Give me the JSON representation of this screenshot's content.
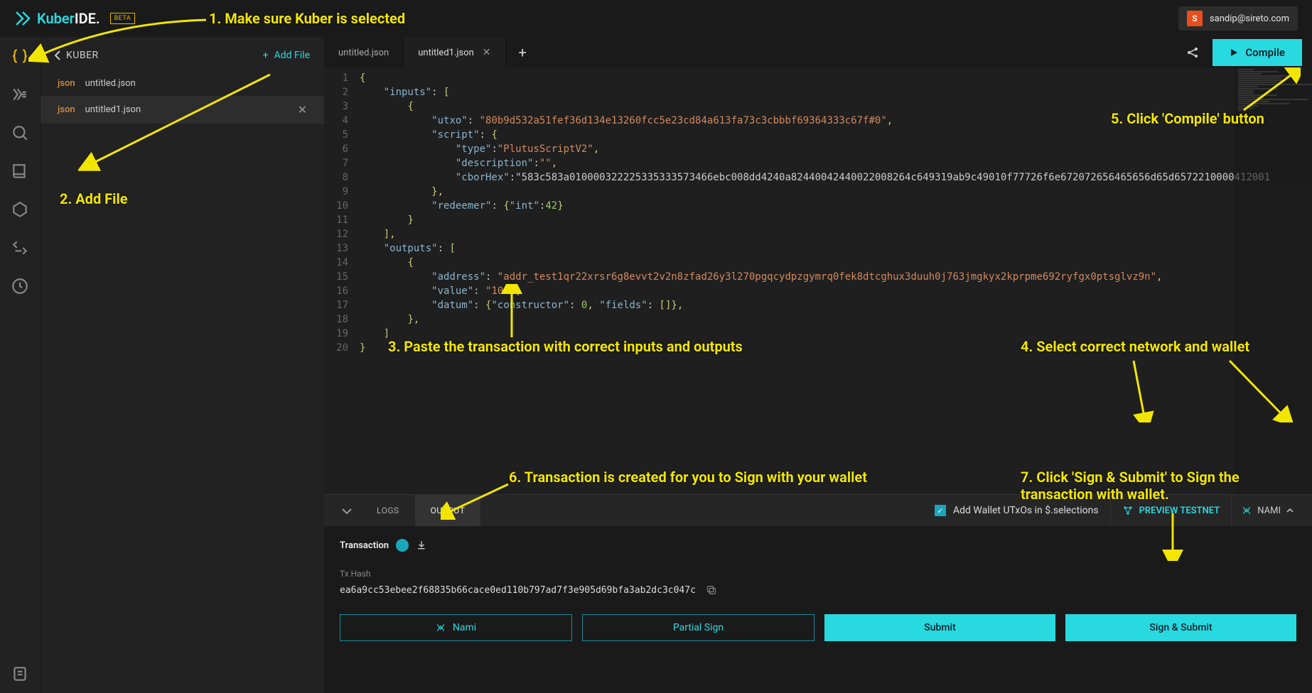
{
  "header": {
    "logo_prefix": "Kuber",
    "logo_suffix": "IDE.",
    "beta": "BETA",
    "user_initial": "S",
    "user_email": "sandip@sireto.com"
  },
  "sidebar": {
    "back_label": "KUBER",
    "add_file_label": "Add File",
    "files": [
      {
        "ext": "json",
        "name": "untitled.json",
        "active": false
      },
      {
        "ext": "json",
        "name": "untitled1.json",
        "active": true
      }
    ]
  },
  "tabs": {
    "items": [
      {
        "label": "untitled.json",
        "active": false,
        "closable": false
      },
      {
        "label": "untitled1.json",
        "active": true,
        "closable": true
      }
    ],
    "compile_label": "Compile"
  },
  "code": {
    "lines": [
      "{",
      "    \"inputs\": [",
      "        {",
      "            \"utxo\": \"80b9d532a51fef36d134e13260fcc5e23cd84a613fa73c3cbbbf69364333c67f#0\",",
      "            \"script\": {",
      "                \"type\":\"PlutusScriptV2\",",
      "                \"description\":\"\",",
      "                \"cborHex\":\"583c583a010000322225335333573466ebc008dd4240a82440042440022008264c649319ab9c49010f77726f6e672072656465656d65d6572210000412001",
      "            },",
      "            \"redeemer\": {\"int\":42}",
      "        }",
      "    ],",
      "    \"outputs\": [",
      "        {",
      "            \"address\": \"addr_test1qr22xrsr6g8evvt2v2n8zfad26y3l270pgqcydpzgymrq0fek8dtcghux3duuh0j763jmgkyx2kprpme692ryfgx0ptsglvz9n\",",
      "            \"value\": \"10A\",",
      "            \"datum\": {\"constructor\": 0, \"fields\": []},",
      "        },",
      "    ]",
      "}"
    ]
  },
  "bottom": {
    "tab_logs": "LOGS",
    "tab_output": "OUTPUT",
    "wallet_utxo_label": "Add Wallet UTxOs in $.selections",
    "network_label": "PREVIEW TESTNET",
    "wallet_label": "NAMI",
    "tx_section": "Transaction",
    "txhash_label": "Tx Hash",
    "txhash_value": "ea6a9cc53ebee2f68835b66cace0ed110b797ad7f3e905d69bfa3ab2dc3c047c",
    "buttons": {
      "nami": "Nami",
      "partial": "Partial Sign",
      "submit": "Submit",
      "sign_submit": "Sign & Submit"
    }
  },
  "annotations": {
    "a1": "1. Make sure Kuber is selected",
    "a2": "2. Add File",
    "a3": "3. Paste the transaction with correct inputs and outputs",
    "a4": "4. Select correct network and wallet",
    "a5": "5. Click 'Compile' button",
    "a6": "6. Transaction is created for you to Sign with your wallet",
    "a7": "7. Click 'Sign & Submit' to Sign the transaction with wallet."
  }
}
